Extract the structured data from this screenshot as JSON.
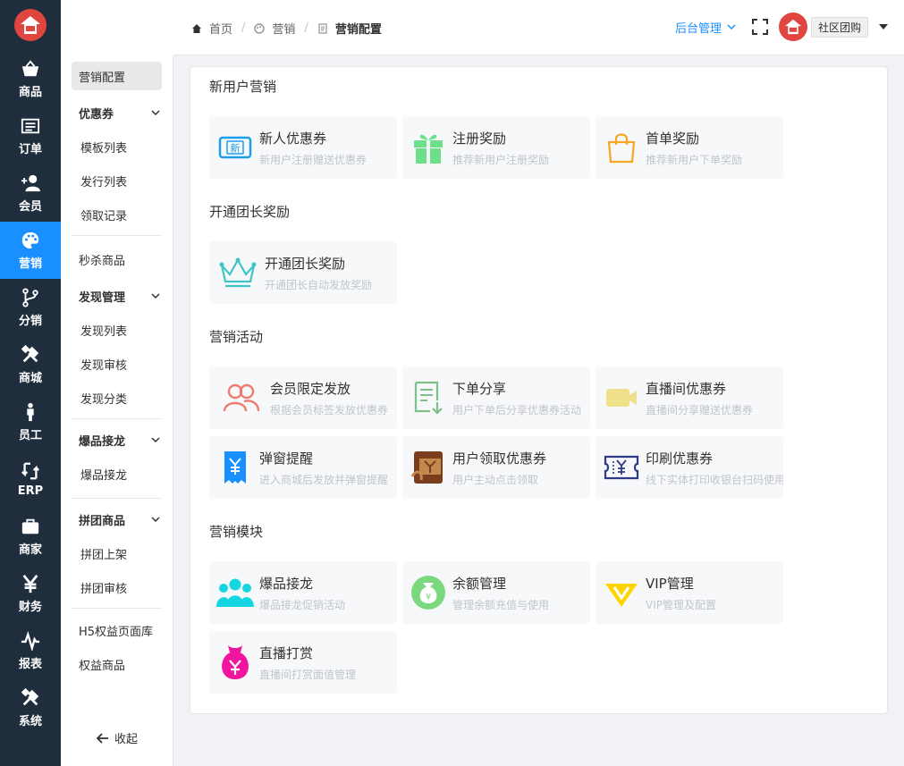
{
  "nav": {
    "items": [
      {
        "label": "商品",
        "icon": "shopping-basket-icon"
      },
      {
        "label": "订单",
        "icon": "order-list-icon"
      },
      {
        "label": "会员",
        "icon": "add-user-icon"
      },
      {
        "label": "营销",
        "icon": "palette-icon"
      },
      {
        "label": "分销",
        "icon": "branch-icon"
      },
      {
        "label": "商城",
        "icon": "tools-icon"
      },
      {
        "label": "员工",
        "icon": "person-icon"
      },
      {
        "label": "ERP",
        "icon": "sync-icon"
      },
      {
        "label": "商家",
        "icon": "briefcase-icon"
      },
      {
        "label": "财务",
        "icon": "yen-icon"
      },
      {
        "label": "报表",
        "icon": "pulse-icon"
      },
      {
        "label": "系统",
        "icon": "settings-tools-icon"
      }
    ],
    "active_index": 3,
    "logo_text": "社区团购"
  },
  "submenu": {
    "active_label": "营销配置",
    "groups": {
      "coupon": {
        "label": "优惠券",
        "items": [
          "模板列表",
          "发行列表",
          "领取记录"
        ]
      },
      "seckill": "秒杀商品",
      "discover": {
        "label": "发现管理",
        "items": [
          "发现列表",
          "发现审核",
          "发现分类"
        ]
      },
      "hot": {
        "label": "爆品接龙",
        "items": [
          "爆品接龙"
        ]
      },
      "group": {
        "label": "拼团商品",
        "items": [
          "拼团上架",
          "拼团审核"
        ]
      },
      "h5": "H5权益页面库",
      "rights": "权益商品"
    },
    "collapse_label": "收起"
  },
  "header": {
    "breadcrumb": [
      "首页",
      "营销",
      "营销配置"
    ],
    "admin_label": "后台管理",
    "shop_tag": "社区团购"
  },
  "sections": [
    {
      "title": "新用户营销",
      "cards": [
        {
          "title": "新人优惠券",
          "desc": "新用户注册赠送优惠券",
          "icon": "new-coupon-icon"
        },
        {
          "title": "注册奖励",
          "desc": "推荐新用户注册奖励",
          "icon": "gift-icon"
        },
        {
          "title": "首单奖励",
          "desc": "推荐新用户下单奖励",
          "icon": "shopping-bag-icon"
        }
      ]
    },
    {
      "title": "开通团长奖励",
      "cards": [
        {
          "title": "开通团长奖励",
          "desc": "开通团长自动发放奖励",
          "icon": "crown-icon"
        }
      ]
    },
    {
      "title": "营销活动",
      "cards": [
        {
          "title": "会员限定发放",
          "desc": "根据会员标签发放优惠券",
          "icon": "members-icon"
        },
        {
          "title": "下单分享",
          "desc": "用户下单后分享优惠券活动",
          "icon": "share-doc-icon"
        },
        {
          "title": "直播间优惠券",
          "desc": "直播间分享赠送优惠券",
          "icon": "video-camera-icon"
        },
        {
          "title": "弹窗提醒",
          "desc": "进入商城后发放并弹窗提醒",
          "icon": "popup-voucher-icon"
        },
        {
          "title": "用户领取优惠券",
          "desc": "用户主动点击领取",
          "icon": "claim-coupon-icon"
        },
        {
          "title": "印刷优惠券",
          "desc": "线下实体打印收银台扫码使用",
          "icon": "print-coupon-icon"
        }
      ]
    },
    {
      "title": "营销模块",
      "cards": [
        {
          "title": "爆品接龙",
          "desc": "爆品接龙促销活动",
          "icon": "group-people-icon"
        },
        {
          "title": "余额管理",
          "desc": "管理余额充值与使用",
          "icon": "money-bag-icon"
        },
        {
          "title": "VIP管理",
          "desc": "VIP管理及配置",
          "icon": "vip-diamond-icon"
        },
        {
          "title": "直播打赏",
          "desc": "直播间打赏面值管理",
          "icon": "reward-bag-icon"
        }
      ]
    }
  ],
  "colors": {
    "nav_bg": "#1f2d3d",
    "active_blue": "#1890ff",
    "logo_red": "#e0463f"
  }
}
